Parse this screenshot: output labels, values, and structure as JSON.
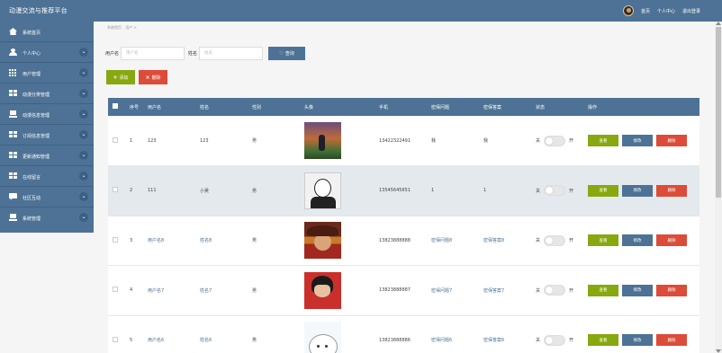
{
  "header": {
    "title": "动漫交流与推荐平台",
    "links": [
      "首页",
      "个人中心",
      "退出登录"
    ]
  },
  "sidebar": {
    "items": [
      {
        "label": "系统首页",
        "icon": "house-icon"
      },
      {
        "label": "个人中心",
        "icon": "user-icon"
      },
      {
        "label": "用户管理",
        "icon": "grid-icon"
      },
      {
        "label": "动漫分类管理",
        "icon": "tiles-icon"
      },
      {
        "label": "动漫信息管理",
        "icon": "laptop-icon"
      },
      {
        "label": "订阅信息管理",
        "icon": "tiles-icon"
      },
      {
        "label": "更新通知管理",
        "icon": "tiles-icon"
      },
      {
        "label": "在线留言",
        "icon": "tiles-icon"
      },
      {
        "label": "社区互动",
        "icon": "chat-icon"
      },
      {
        "label": "系统管理",
        "icon": "laptop-icon"
      }
    ]
  },
  "breadcrumb": [
    "系统首页",
    "用户 >"
  ],
  "search": {
    "username_label": "用户名",
    "username_placeholder": "用户名",
    "name_label": "姓名",
    "name_placeholder": "姓名",
    "button_label": "查询"
  },
  "actions": {
    "add_label": "添加",
    "delete_label": "删除"
  },
  "table": {
    "headers": [
      "",
      "序号",
      "用户名",
      "姓名",
      "性别",
      "头像",
      "手机",
      "密保问题",
      "密保答案",
      "状态",
      "操作"
    ],
    "rows": [
      {
        "no": "1",
        "username": "123",
        "name": "123",
        "gender": "男",
        "phone": "13422322491",
        "question": "我",
        "answer": "我"
      },
      {
        "no": "2",
        "username": "111",
        "name": "小吴",
        "gender": "男",
        "phone": "13545645651",
        "question": "1",
        "answer": "1"
      },
      {
        "no": "3",
        "username": "用户名8",
        "name": "姓名8",
        "gender": "男",
        "phone": "13823888888",
        "question": "密保问题8",
        "answer": "密保答案8"
      },
      {
        "no": "4",
        "username": "用户名7",
        "name": "姓名7",
        "gender": "男",
        "phone": "13823888887",
        "question": "密保问题7",
        "answer": "密保答案7"
      },
      {
        "no": "5",
        "username": "用户名6",
        "name": "姓名6",
        "gender": "男",
        "phone": "13823888886",
        "question": "密保问题6",
        "answer": "密保答案6"
      }
    ],
    "toggle_off": "关",
    "toggle_on": "开",
    "op_view": "查看",
    "op_edit": "修改",
    "op_delete": "删除"
  },
  "colors": {
    "primary": "#4d7295",
    "success": "#87a80f",
    "danger": "#dd4b39",
    "row_alt": "#e4e9ee"
  }
}
